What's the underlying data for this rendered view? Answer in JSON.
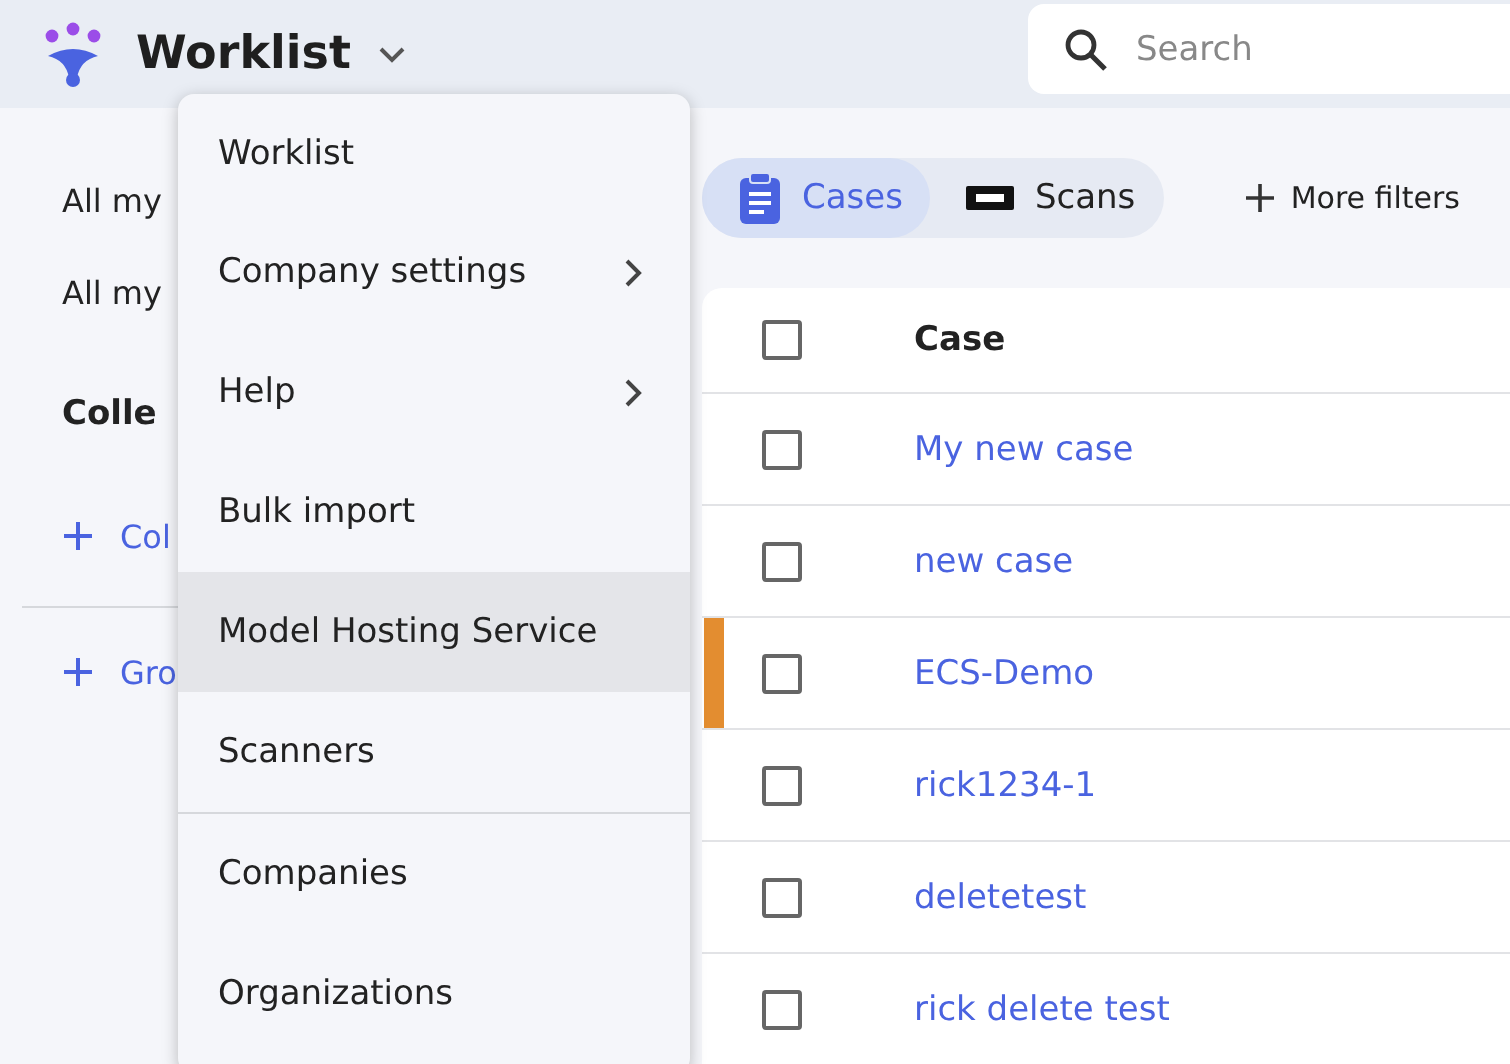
{
  "header": {
    "title": "Worklist",
    "search": {
      "placeholder": "Search"
    }
  },
  "sidebar": {
    "items": [
      {
        "kind": "link",
        "label": "All my"
      },
      {
        "kind": "link",
        "label": "All my"
      },
      {
        "kind": "heading",
        "label": "Colle"
      },
      {
        "kind": "add",
        "label": "Col"
      },
      {
        "kind": "divider"
      },
      {
        "kind": "add",
        "label": "Gro"
      }
    ]
  },
  "view_toggle": [
    {
      "label": "Cases",
      "selected": true
    },
    {
      "label": "Scans",
      "selected": false
    }
  ],
  "more_filters": "More filters",
  "table": {
    "select_all_checked": false,
    "columns": [
      "Case"
    ],
    "rows": [
      {
        "case": "My new case",
        "checked": false,
        "flagged": false
      },
      {
        "case": "new case",
        "checked": false,
        "flagged": false
      },
      {
        "case": "ECS-Demo",
        "checked": false,
        "flagged": true
      },
      {
        "case": "rick1234-1",
        "checked": false,
        "flagged": false
      },
      {
        "case": "deletetest",
        "checked": false,
        "flagged": false
      },
      {
        "case": "rick delete test",
        "checked": false,
        "flagged": false
      }
    ]
  },
  "menu": {
    "items": [
      {
        "label": "Worklist",
        "submenu": false,
        "selected": false,
        "divider_after": false
      },
      {
        "label": "Company settings",
        "submenu": true,
        "selected": false,
        "divider_after": false
      },
      {
        "label": "Help",
        "submenu": true,
        "selected": false,
        "divider_after": false
      },
      {
        "label": "Bulk import",
        "submenu": false,
        "selected": false,
        "divider_after": false
      },
      {
        "label": "Model Hosting Service",
        "submenu": false,
        "selected": true,
        "divider_after": false
      },
      {
        "label": "Scanners",
        "submenu": false,
        "selected": false,
        "divider_after": true
      },
      {
        "label": "Companies",
        "submenu": false,
        "selected": false,
        "divider_after": false
      },
      {
        "label": "Organizations",
        "submenu": false,
        "selected": false,
        "divider_after": false
      }
    ]
  }
}
